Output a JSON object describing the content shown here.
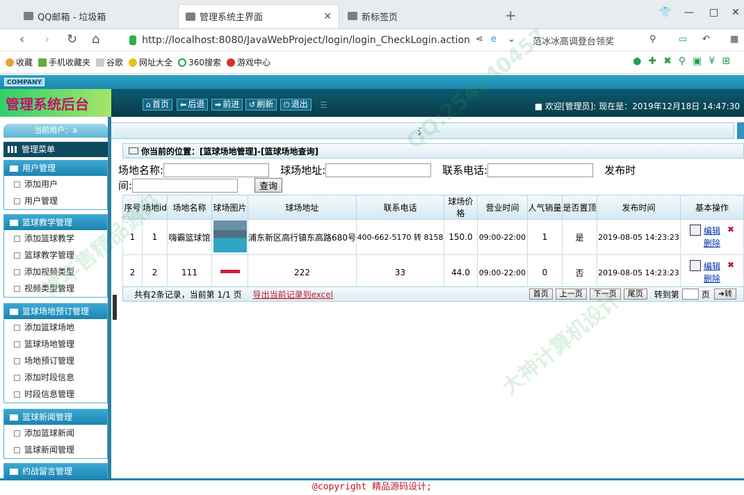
{
  "browser": {
    "tabs": [
      {
        "label": "QQ邮箱 - 垃圾箱"
      },
      {
        "label": "管理系统主界面"
      },
      {
        "label": "新标签页"
      }
    ],
    "url": "http://localhost:8080/JavaWebProject/login/login_CheckLogin.action",
    "search_hint": "范冰冰高调登台领奖",
    "bookmarks": [
      "收藏",
      "手机收藏夹",
      "谷歌",
      "网址大全",
      "360搜索",
      "游戏中心"
    ]
  },
  "app": {
    "company": "COMPANY",
    "title": "管理系统后台",
    "nav_buttons": [
      "首页",
      "后退",
      "前进",
      "刷新",
      "退出"
    ],
    "welcome": "欢迎[管理员]:  现在是：2019年12月18日 14:47:30",
    "sub_bar_text": "氵"
  },
  "sidebar": {
    "current_user": "当前用户：a",
    "menu_title": "管理菜单",
    "groups": [
      {
        "title": "用户管理",
        "items": [
          "添加用户",
          "用户管理"
        ]
      },
      {
        "title": "篮球教学管理",
        "items": [
          "添加篮球教学",
          "篮球教学管理",
          "添加视频类型",
          "视频类型管理"
        ]
      },
      {
        "title": "篮球场地预订管理",
        "items": [
          "添加篮球场地",
          "篮球场地管理",
          "场地预订管理",
          "添加时段信息",
          "时段信息管理"
        ]
      },
      {
        "title": "篮球新闻管理",
        "items": [
          "添加篮球新闻",
          "篮球新闻管理"
        ]
      },
      {
        "title": "约战留言管理",
        "items": []
      }
    ]
  },
  "main": {
    "location_label": "你当前的位置：",
    "location_path": "[篮球场地管理]-[篮球场地查询]",
    "search": {
      "name_label": "场地名称:",
      "address_label": "球场地址:",
      "phone_label": "联系电话:",
      "date_label_1": "发布时",
      "date_label_2": "间:",
      "query_button": "查询"
    },
    "table": {
      "headers": [
        "序号",
        "场地id",
        "场地名称",
        "球场图片",
        "球场地址",
        "联系电话",
        "球场价格",
        "营业时间",
        "人气销量",
        "是否置顶",
        "发布时间",
        "基本操作"
      ],
      "rows": [
        {
          "seq": "1",
          "id": "1",
          "name": "嗨霸篮球馆",
          "address": "浦东新区高行镇东高路680号",
          "phone": "400-662-5170 转 8158",
          "price": "150.0",
          "hours": "09:00-22:00",
          "sales": "1",
          "top": "是",
          "date": "2019-08-05 14:23:23"
        },
        {
          "seq": "2",
          "id": "2",
          "name": "111",
          "address": "222",
          "phone": "33",
          "price": "44.0",
          "hours": "09:00-22:00",
          "sales": "0",
          "top": "否",
          "date": "2019-08-05 14:23:23"
        }
      ],
      "edit_label": "编辑",
      "delete_label": "删除"
    },
    "footer": {
      "summary": "共有2条记录，当前第 1/1 页",
      "export": "导出当前记录到excel",
      "first": "首页",
      "prev": "上一页",
      "next": "下一页",
      "last": "尾页",
      "goto_label": "转到第",
      "page_unit": "页",
      "go": "转"
    }
  },
  "copyright": "@copyright 精品源码设计;",
  "watermarks": [
    "QQ:254540457",
    "常年售精品源码",
    "大神计算机设计"
  ]
}
